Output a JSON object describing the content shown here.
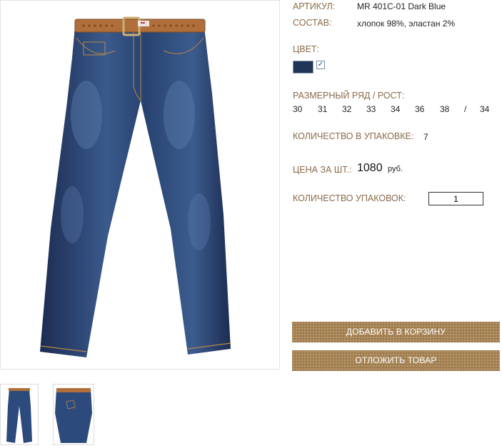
{
  "product": {
    "article_label": "АРТИКУЛ:",
    "article_value": "MR 401C-01 Dark Blue",
    "composition_label": "СОСТАВ:",
    "composition_value": "хлопок 98%, эластан 2%",
    "color_label": "ЦВЕТ:",
    "color_swatch": "#1f3457",
    "color_checked_mark": "✓",
    "size_label": "РАЗМЕРНЫЙ РЯД / РОСТ:",
    "sizes": [
      "30",
      "31",
      "32",
      "33",
      "34",
      "36",
      "38",
      "/",
      "34"
    ],
    "pack_qty_label": "КОЛИЧЕСТВО В УПАКОВКЕ:",
    "pack_qty_value": "7",
    "price_label": "ЦЕНА ЗА ШТ.:",
    "price_value": "1080",
    "price_currency": "руб.",
    "packs_label": "КОЛИЧЕСТВО УПАКОВОК:",
    "packs_value": "1"
  },
  "actions": {
    "add_to_cart": "ДОБАВИТЬ В КОРЗИНУ",
    "postpone": "ОТЛОЖИТЬ ТОВАР"
  },
  "colors": {
    "label_brown": "#8a6a48",
    "button_brown": "#a27e4e",
    "denim": "#1f3457"
  }
}
